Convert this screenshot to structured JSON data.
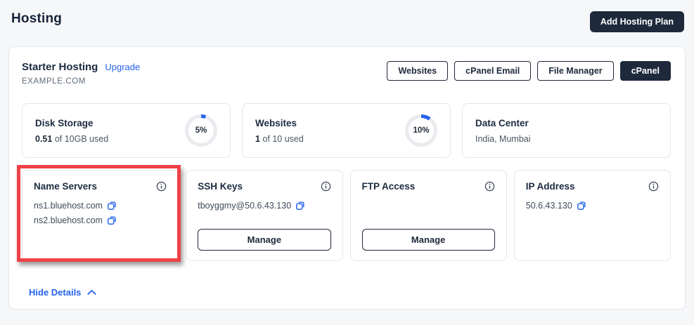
{
  "colors": {
    "accent": "#2563eb",
    "dark": "#1e293b",
    "highlight_red": "#ef4146",
    "donut_track": "#e9ebef"
  },
  "page": {
    "title": "Hosting"
  },
  "topbar": {
    "add_plan_label": "Add Hosting Plan"
  },
  "plan": {
    "name": "Starter Hosting",
    "upgrade_label": "Upgrade",
    "domain": "EXAMPLE.COM",
    "tabs": [
      {
        "label": "Websites",
        "active": false
      },
      {
        "label": "cPanel Email",
        "active": false
      },
      {
        "label": "File Manager",
        "active": false
      },
      {
        "label": "cPanel",
        "active": true
      }
    ]
  },
  "stats": [
    {
      "title": "Disk Storage",
      "value_bold": "0.51",
      "value_rest": " of 10GB used",
      "percent": 5,
      "percent_label": "5%"
    },
    {
      "title": "Websites",
      "value_bold": "1",
      "value_rest": " of 10 used",
      "percent": 10,
      "percent_label": "10%"
    },
    {
      "title": "Data Center",
      "value_bold": "",
      "value_rest": "India, Mumbai"
    }
  ],
  "details": [
    {
      "title": "Name Servers",
      "items": {
        "0": "ns1.bluehost.com",
        "1": "ns2.bluehost.com"
      },
      "highlighted": true
    },
    {
      "title": "SSH Keys",
      "items": {
        "0": "tboyggmy@50.6.43.130"
      },
      "button_label": "Manage"
    },
    {
      "title": "FTP Access",
      "button_label": "Manage"
    },
    {
      "title": "IP Address",
      "items": {
        "0": "50.6.43.130"
      }
    }
  ],
  "footer": {
    "hide_details_label": "Hide Details"
  }
}
